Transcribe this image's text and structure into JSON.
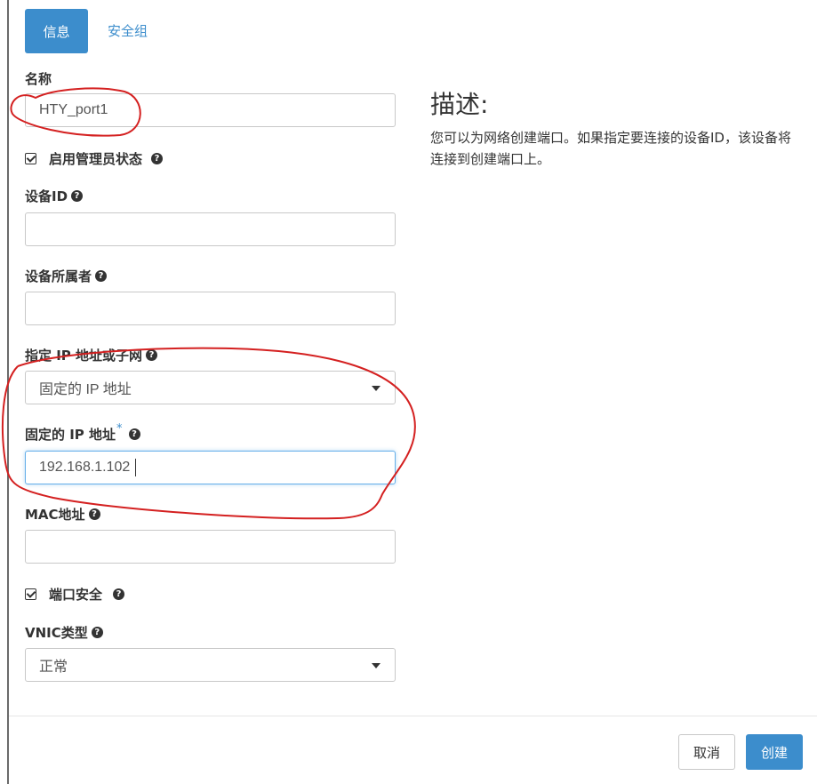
{
  "tabs": {
    "active": "信息",
    "other": "安全组"
  },
  "form": {
    "name_label": "名称",
    "name_value": "HTY_port1",
    "admin_state_label": "启用管理员状态",
    "device_id_label": "设备ID",
    "device_owner_label": "设备所属者",
    "ip_mode_label": "指定 IP 地址或子网",
    "ip_mode_value": "固定的 IP 地址",
    "fixed_ip_label": "固定的 IP 地址",
    "fixed_ip_required": "*",
    "fixed_ip_value": "192.168.1.102",
    "mac_label": "MAC地址",
    "port_security_label": "端口安全",
    "vnic_label": "VNIC类型",
    "vnic_value": "正常",
    "help_glyph": "?"
  },
  "description": {
    "title": "描述:",
    "text": "您可以为网络创建端口。如果指定要连接的设备ID，该设备将连接到创建端口上。"
  },
  "footer": {
    "cancel": "取消",
    "create": "创建"
  },
  "colors": {
    "primary": "#3c8dcc",
    "annotation": "#d42020"
  }
}
